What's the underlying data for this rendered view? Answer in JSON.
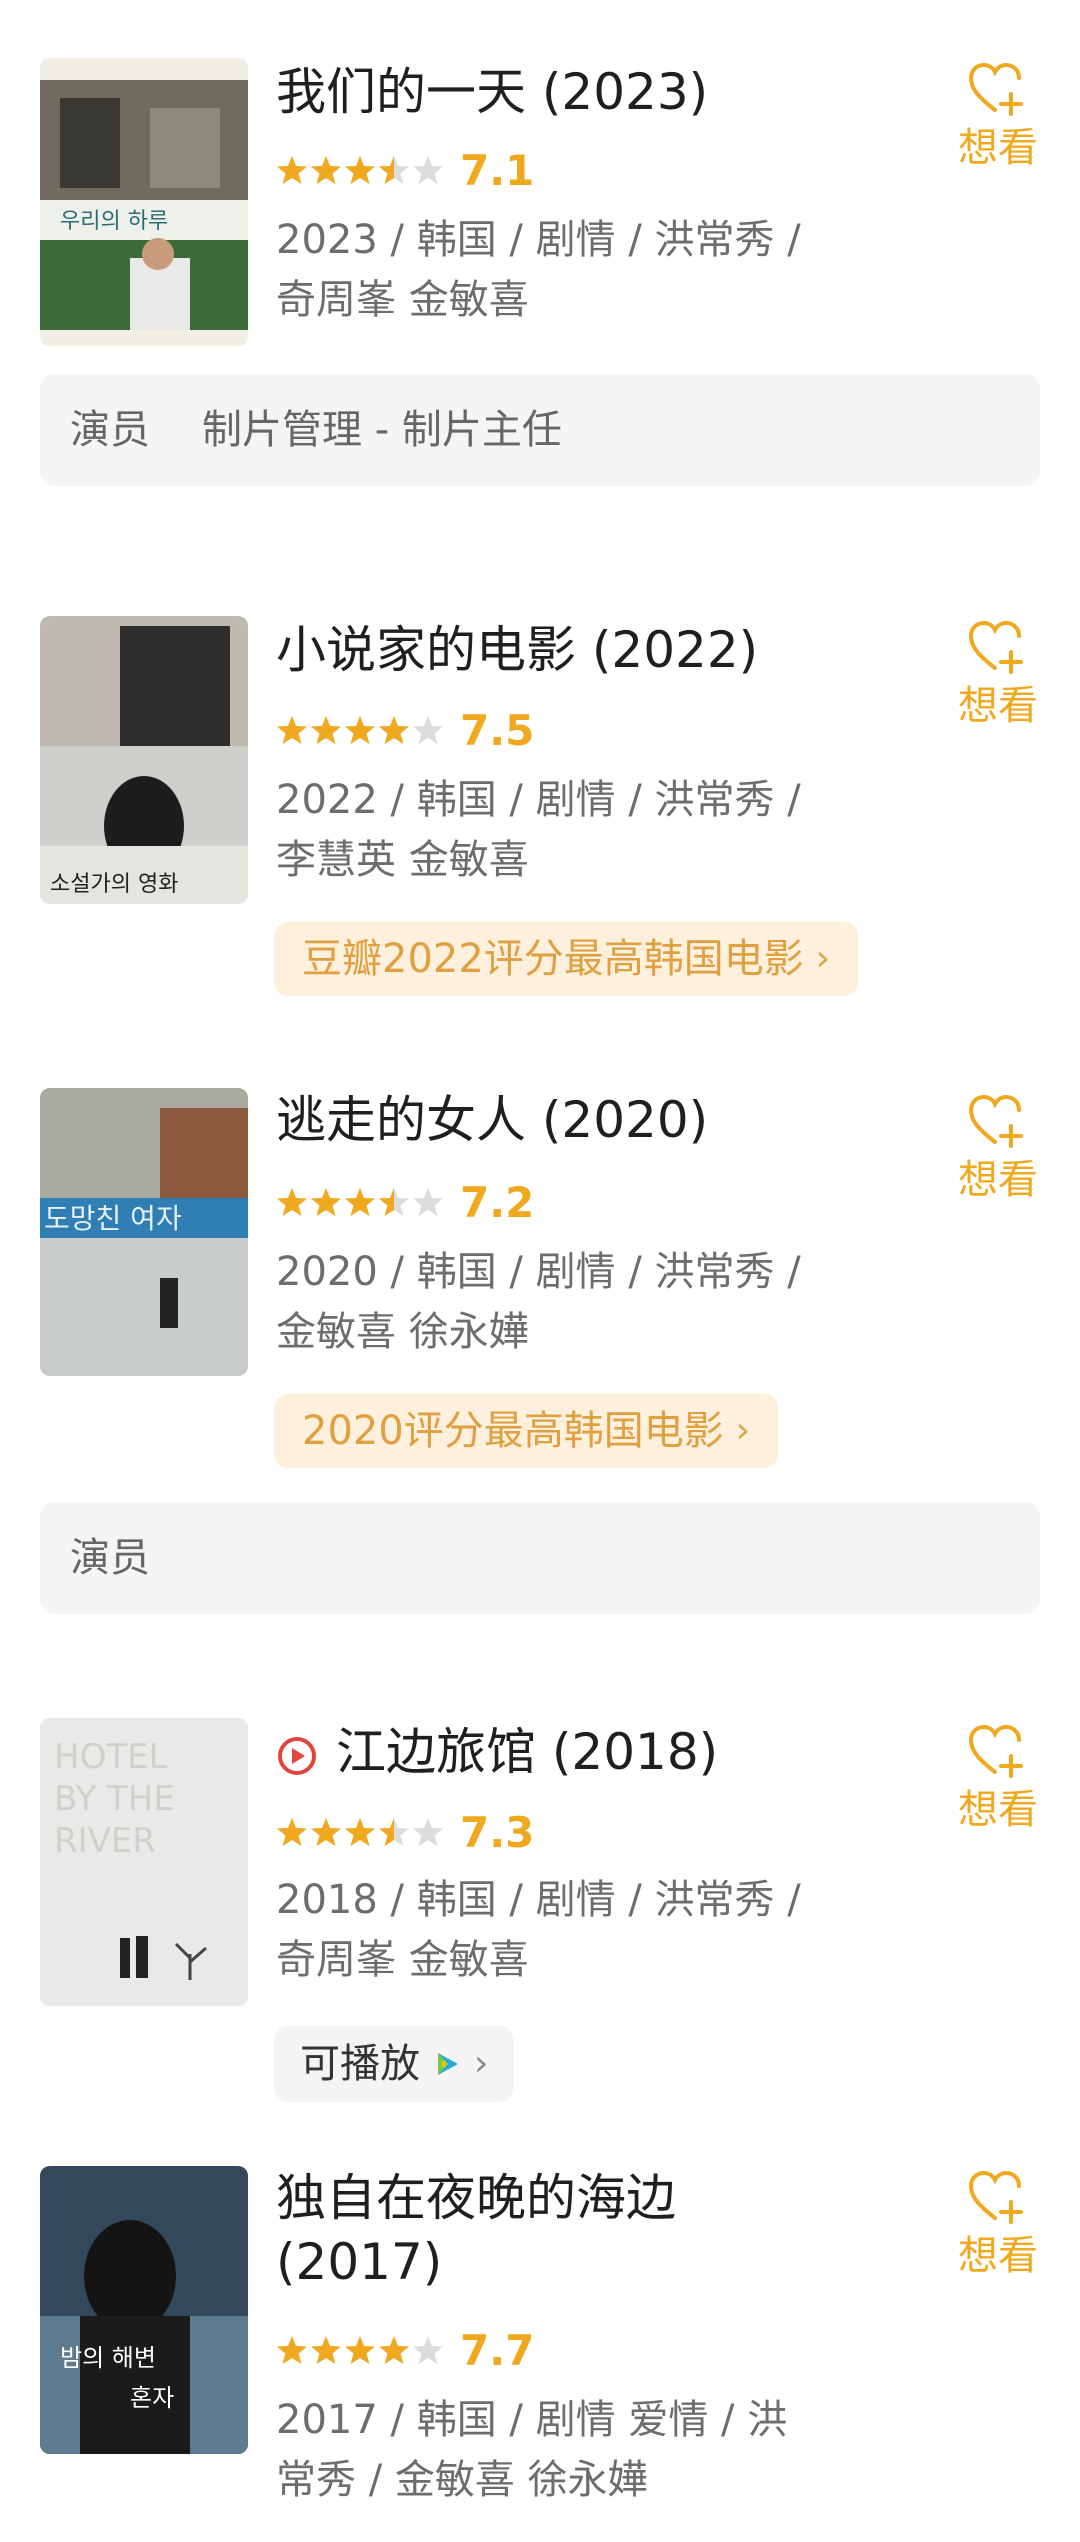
{
  "accent_color": "#f0a81f",
  "movies": [
    {
      "title": "我们的一天 (2023)",
      "rating": "7.1",
      "stars": 3.5,
      "meta": "2023 / 韩国 / 剧情 / 洪常秀 / 奇周峯 金敏喜",
      "want_label": "想看",
      "role": {
        "label": "演员",
        "extra": "制片管理 - 制片主任"
      }
    },
    {
      "title": "小说家的电影 (2022)",
      "rating": "7.5",
      "stars": 4,
      "meta": "2022 / 韩国 / 剧情 / 洪常秀 / 李慧英 金敏喜",
      "want_label": "想看",
      "badge": "豆瓣2022评分最高韩国电影"
    },
    {
      "title": "逃走的女人 (2020)",
      "rating": "7.2",
      "stars": 3.5,
      "meta": "2020 / 韩国 / 剧情 / 洪常秀 / 金敏喜 徐永嬅",
      "want_label": "想看",
      "badge": "2020评分最高韩国电影",
      "role": {
        "label": "演员"
      }
    },
    {
      "title": "江边旅馆 (2018)",
      "rating": "7.3",
      "stars": 3.5,
      "meta": "2018 / 韩国 / 剧情 / 洪常秀 / 奇周峯 金敏喜",
      "want_label": "想看",
      "play_label": "可播放"
    },
    {
      "title": "独自在夜晚的海边 (2017)",
      "rating": "7.7",
      "stars": 4,
      "meta": "2017 / 韩国 / 剧情 爱情 / 洪常秀 / 金敏喜 徐永嬅",
      "want_label": "想看"
    }
  ],
  "icons": {
    "want": "heart-plus-icon",
    "play": "play-circle-icon",
    "star": "star-icon",
    "video_app": "video-app-icon"
  }
}
